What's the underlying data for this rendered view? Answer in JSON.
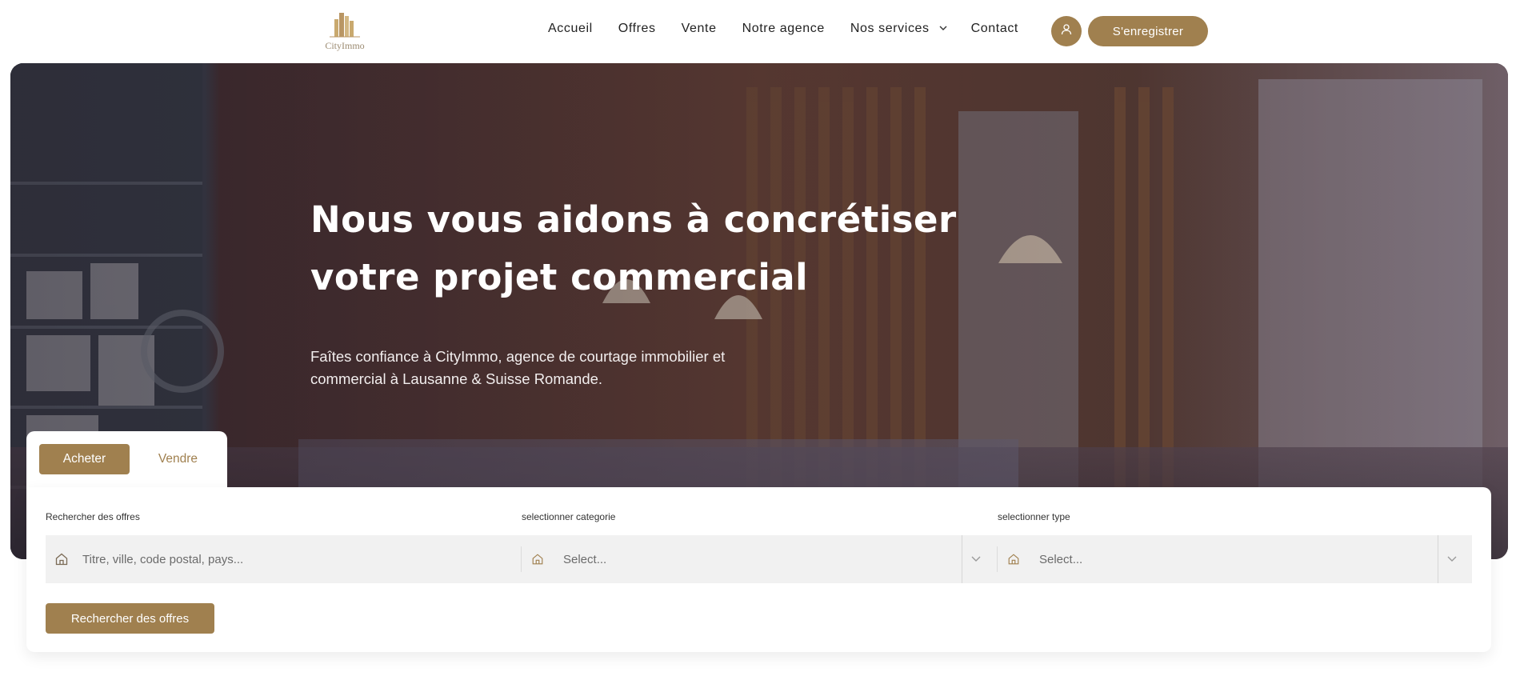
{
  "brand": {
    "logo_text": "CityImmo",
    "accent": "#a0804f"
  },
  "nav": {
    "items": [
      {
        "label": "Accueil"
      },
      {
        "label": "Offres"
      },
      {
        "label": "Vente"
      },
      {
        "label": "Notre agence"
      },
      {
        "label": "Nos services"
      },
      {
        "label": "Contact"
      }
    ],
    "user_icon": "user-icon",
    "register_label": "S'enregistrer"
  },
  "hero": {
    "title": "Nous vous aidons à concrétiser votre projet commercial",
    "subtitle": "Faîtes confiance à CityImmo, agence de courtage immobilier et commercial à Lausanne & Suisse Romande."
  },
  "tabs": [
    {
      "label": "Acheter",
      "active": true
    },
    {
      "label": "Vendre",
      "active": false
    }
  ],
  "search": {
    "fields": [
      {
        "label": "Rechercher des offres",
        "placeholder": "Titre, ville, code postal, pays...",
        "icon": "home-icon"
      },
      {
        "label": "selectionner categorie",
        "placeholder": "Select...",
        "icon": "home-icon"
      },
      {
        "label": "selectionner type",
        "placeholder": "Select...",
        "icon": "home-icon"
      }
    ],
    "submit_label": "Rechercher des offres"
  }
}
